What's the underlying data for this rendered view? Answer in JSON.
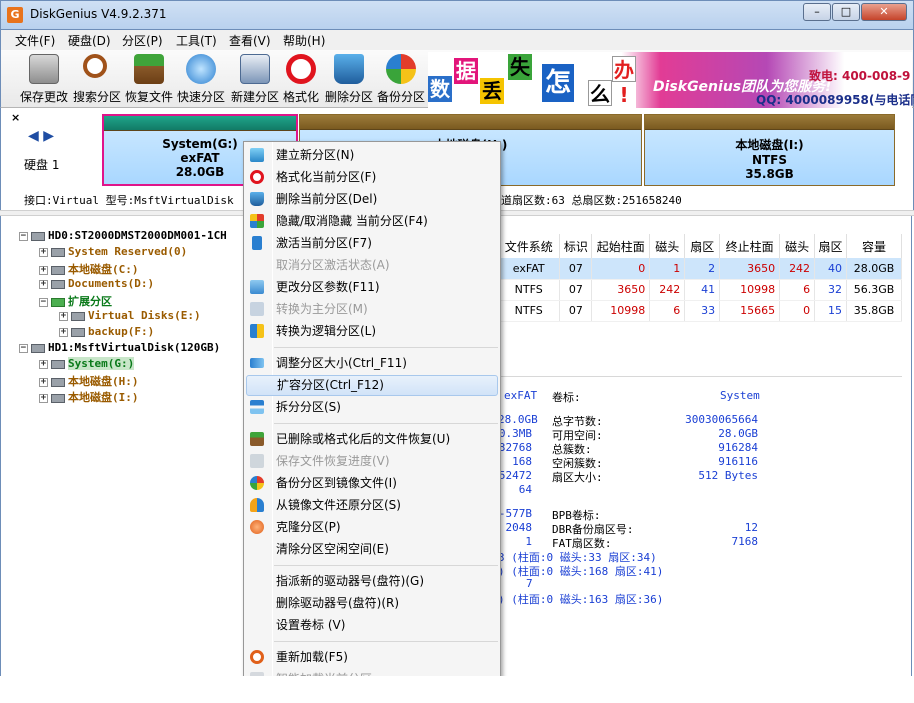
{
  "window": {
    "title": "DiskGenius V4.9.2.371",
    "app_icon": "G",
    "min": "–",
    "max": "□",
    "close": "✕"
  },
  "menu": [
    "文件(F)",
    "硬盘(D)",
    "分区(P)",
    "工具(T)",
    "查看(V)",
    "帮助(H)"
  ],
  "toolbar": [
    {
      "label": "保存更改",
      "icon": "save-icon"
    },
    {
      "label": "搜索分区",
      "icon": "search-icon"
    },
    {
      "label": "恢复文件",
      "icon": "recover-icon"
    },
    {
      "label": "快速分区",
      "icon": "quick-partition-icon"
    },
    {
      "label": "新建分区",
      "icon": "new-partition-icon"
    },
    {
      "label": "格式化",
      "icon": "format-icon"
    },
    {
      "label": "删除分区",
      "icon": "delete-icon"
    },
    {
      "label": "备份分区",
      "icon": "backup-icon"
    }
  ],
  "banner": {
    "tiles": [
      "数",
      "据",
      "丢",
      "失",
      "怎",
      "么",
      "办",
      "!"
    ],
    "brand": "DiskGenius团队为您服务!",
    "phone": "致电: 400-008-9",
    "qq": "QQ: 4000089958(与电话同"
  },
  "disk_panel": {
    "close": "×",
    "arrows": "◀ ▶",
    "disk_label": "硬盘 1",
    "partitions": [
      {
        "name": "System(G:)",
        "fs": "exFAT",
        "size": "28.0GB"
      },
      {
        "name": "本地磁盘(H:)",
        "fs": "NTFS",
        "size": "56.3GB"
      },
      {
        "name": "本地磁盘(I:)",
        "fs": "NTFS",
        "size": "35.8GB"
      }
    ],
    "info_left": "接口:Virtual  型号:MsftVirtualDisk  ",
    "info_right": "55  每道扇区数:63  总扇区数:251658240"
  },
  "tree": [
    {
      "text": "HD0:ST2000DMST2000DM001-1CH",
      "color": "black",
      "level": 0
    },
    {
      "text": "System Reserved(0)",
      "color": "brown",
      "level": 1
    },
    {
      "text": "本地磁盘(C:)",
      "color": "brown",
      "level": 1
    },
    {
      "text": "Documents(D:)",
      "color": "brown",
      "level": 1
    },
    {
      "text": "扩展分区",
      "color": "green",
      "level": 1
    },
    {
      "text": "Virtual Disks(E:)",
      "color": "brown",
      "level": 2
    },
    {
      "text": "backup(F:)",
      "color": "brown",
      "level": 2
    },
    {
      "text": "HD1:MsftVirtualDisk(120GB)",
      "color": "black",
      "level": 0
    },
    {
      "text": "System(G:)",
      "color": "green",
      "level": 1
    },
    {
      "text": "本地磁盘(H:)",
      "color": "brown",
      "level": 1
    },
    {
      "text": "本地磁盘(I:)",
      "color": "brown",
      "level": 1
    }
  ],
  "table": {
    "headers": [
      "文件系统",
      "标识",
      "起始柱面",
      "磁头",
      "扇区",
      "终止柱面",
      "磁头",
      "扇区",
      "容量"
    ],
    "rows": [
      [
        "exFAT",
        "07",
        "0",
        "1",
        "2",
        "3650",
        "242",
        "40",
        "28.0GB"
      ],
      [
        "NTFS",
        "07",
        "3650",
        "242",
        "41",
        "10998",
        "6",
        "32",
        "56.3GB"
      ],
      [
        "NTFS",
        "07",
        "10998",
        "6",
        "33",
        "15665",
        "0",
        "15",
        "35.8GB"
      ]
    ]
  },
  "details": {
    "fs": "exFAT",
    "vol_label_k": "卷标:",
    "vol_label_v": "System",
    "left_values": [
      "28.0GB",
      "0.3MB",
      "32768",
      "168",
      "52472",
      "64"
    ],
    "right_keys": [
      "总字节数:",
      "可用空间:",
      "总簇数:",
      "空闲簇数:",
      "扇区大小:"
    ],
    "right_values": [
      "30030065664",
      "28.0GB",
      "916284",
      "916116",
      "512 Bytes"
    ],
    "block2_left": [
      "-577B",
      "2048",
      "1"
    ],
    "block2_keys": [
      "BPB卷标:",
      "DBR备份扇区号:",
      "FAT扇区数:"
    ],
    "block2_values": [
      "",
      "12",
      "7168"
    ],
    "chs_lines": [
      "3 (柱面:0 磁头:33 扇区:34)",
      ") (柱面:0 磁头:168 扇区:41)",
      "7",
      ") (柱面:0 磁头:163 扇区:36)"
    ]
  },
  "context_menu": [
    {
      "label": "建立新分区(N)",
      "enabled": true,
      "icon": "new-partition-icon"
    },
    {
      "label": "格式化当前分区(F)",
      "enabled": true,
      "icon": "format-icon"
    },
    {
      "label": "删除当前分区(Del)",
      "enabled": true,
      "icon": "delete-icon"
    },
    {
      "label": "隐藏/取消隐藏 当前分区(F4)",
      "enabled": true,
      "icon": "hide-icon"
    },
    {
      "label": "激活当前分区(F7)",
      "enabled": true,
      "icon": "activate-icon"
    },
    {
      "label": "取消分区激活状态(A)",
      "enabled": false,
      "icon": ""
    },
    {
      "label": "更改分区参数(F11)",
      "enabled": true,
      "icon": "params-icon"
    },
    {
      "label": "转换为主分区(M)",
      "enabled": false,
      "icon": "to-primary-icon"
    },
    {
      "label": "转换为逻辑分区(L)",
      "enabled": true,
      "icon": "to-logical-icon"
    },
    {
      "label": "调整分区大小(Ctrl_F11)",
      "enabled": true,
      "icon": "resize-icon"
    },
    {
      "label": "扩容分区(Ctrl_F12)",
      "enabled": true,
      "icon": "",
      "highlight": true
    },
    {
      "label": "拆分分区(S)",
      "enabled": true,
      "icon": "split-icon"
    },
    {
      "label": "已删除或格式化后的文件恢复(U)",
      "enabled": true,
      "icon": "recover-icon"
    },
    {
      "label": "保存文件恢复进度(V)",
      "enabled": false,
      "icon": "save-progress-icon"
    },
    {
      "label": "备份分区到镜像文件(I)",
      "enabled": true,
      "icon": "backup-icon"
    },
    {
      "label": "从镜像文件还原分区(S)",
      "enabled": true,
      "icon": "restore-icon"
    },
    {
      "label": "克隆分区(P)",
      "enabled": true,
      "icon": "clone-icon"
    },
    {
      "label": "清除分区空闲空间(E)",
      "enabled": true,
      "icon": ""
    },
    {
      "label": "指派新的驱动器号(盘符)(G)",
      "enabled": true,
      "icon": ""
    },
    {
      "label": "删除驱动器号(盘符)(R)",
      "enabled": true,
      "icon": ""
    },
    {
      "label": "设置卷标 (V)",
      "enabled": true,
      "icon": ""
    },
    {
      "label": "重新加载(F5)",
      "enabled": true,
      "icon": "reload-icon"
    },
    {
      "label": "智能加载当前分区",
      "enabled": false,
      "icon": "smart-load-icon"
    }
  ],
  "colors": {
    "accent": "#1a3fd4",
    "title_bar": "#c4d7ef",
    "partition_fill": "#a9d7ff",
    "partition_cap": "#8a6a2a",
    "selected_row": "#cde5fb"
  }
}
